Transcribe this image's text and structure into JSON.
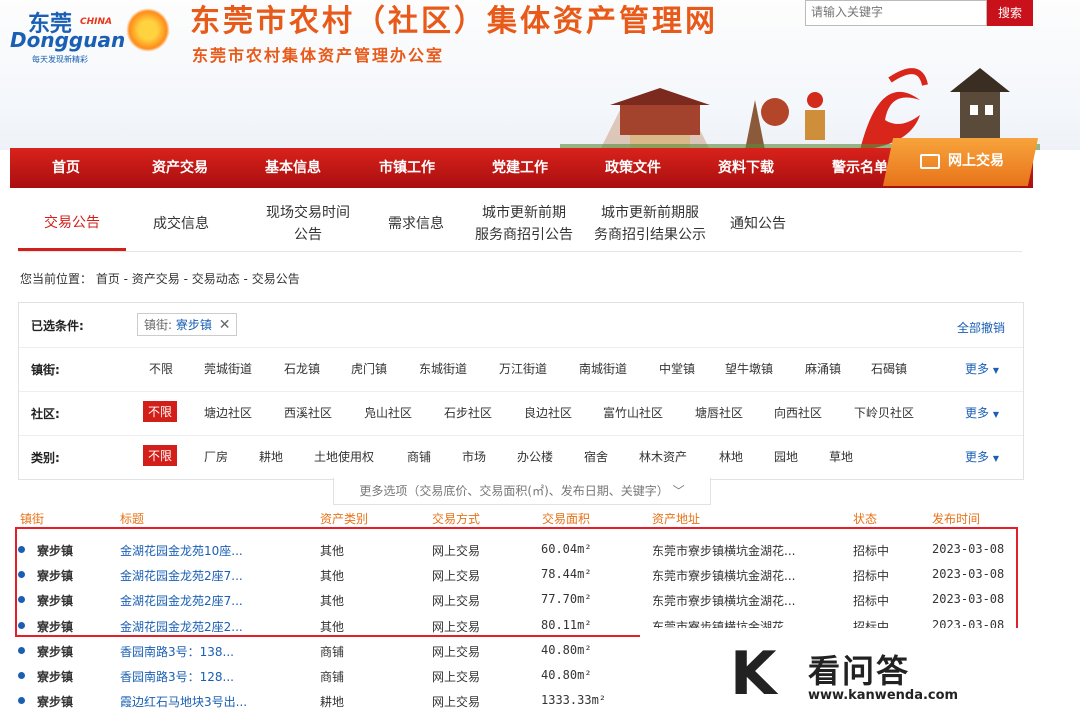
{
  "logo": {
    "cn": "东莞",
    "china": "CHINA",
    "en": "Dongguan",
    "slogan": "每天发现新精彩"
  },
  "site": {
    "title": "东莞市农村（社区）集体资产管理网",
    "subtitle": "东莞市农村集体资产管理办公室"
  },
  "search": {
    "placeholder": "请输入关键字",
    "button": "搜索"
  },
  "nav": {
    "items": [
      "首页",
      "资产交易",
      "基本信息",
      "市镇工作",
      "党建工作",
      "政策文件",
      "资料下载",
      "警示名单"
    ],
    "online": "网上交易"
  },
  "subtabs": [
    "交易公告",
    "成交信息",
    "现场交易时间\n公告",
    "需求信息",
    "城市更新前期\n服务商招引公告",
    "城市更新前期服\n务商招引结果公示",
    "通知公告"
  ],
  "breadcrumb": "您当前位置： 首页 - 资产交易 - 交易动态 - 交易公告",
  "filters": {
    "selected_label": "已选条件:",
    "selected_tag_key": "镇街:",
    "selected_tag_value": "寮步镇",
    "clear_all": "全部撤销",
    "town_label": "镇街:",
    "towns": [
      "不限",
      "莞城街道",
      "石龙镇",
      "虎门镇",
      "东城街道",
      "万江街道",
      "南城街道",
      "中堂镇",
      "望牛墩镇",
      "麻涌镇",
      "石碣镇"
    ],
    "community_label": "社区:",
    "communities": [
      "不限",
      "塘边社区",
      "西溪社区",
      "凫山社区",
      "石步社区",
      "良边社区",
      "富竹山社区",
      "塘唇社区",
      "向西社区",
      "下岭贝社区"
    ],
    "category_label": "类别:",
    "categories": [
      "不限",
      "厂房",
      "耕地",
      "土地使用权",
      "商铺",
      "市场",
      "办公楼",
      "宿舍",
      "林木资产",
      "林地",
      "园地",
      "草地"
    ],
    "more": "更多",
    "more_options": "更多选项（交易底价、交易面积(㎡)、发布日期、关键字）"
  },
  "table": {
    "headers": [
      "镇街",
      "标题",
      "资产类别",
      "交易方式",
      "交易面积",
      "资产地址",
      "状态",
      "发布时间"
    ],
    "rows": [
      [
        "寮步镇",
        "金湖花园金龙苑10座...",
        "其他",
        "网上交易",
        "60.04m²",
        "东莞市寮步镇横坑金湖花...",
        "招标中",
        "2023-03-08"
      ],
      [
        "寮步镇",
        "金湖花园金龙苑2座7...",
        "其他",
        "网上交易",
        "78.44m²",
        "东莞市寮步镇横坑金湖花...",
        "招标中",
        "2023-03-08"
      ],
      [
        "寮步镇",
        "金湖花园金龙苑2座7...",
        "其他",
        "网上交易",
        "77.70m²",
        "东莞市寮步镇横坑金湖花...",
        "招标中",
        "2023-03-08"
      ],
      [
        "寮步镇",
        "金湖花园金龙苑2座2...",
        "其他",
        "网上交易",
        "80.11m²",
        "东莞市寮步镇横坑金湖花",
        "招标中",
        "2023-03-08"
      ],
      [
        "寮步镇",
        "香园南路3号：138...",
        "商铺",
        "网上交易",
        "40.80m²",
        "",
        "",
        ""
      ],
      [
        "寮步镇",
        "香园南路3号：128...",
        "商铺",
        "网上交易",
        "40.80m²",
        "",
        "",
        ""
      ],
      [
        "寮步镇",
        "霞边红石马地块3号出...",
        "耕地",
        "网上交易",
        "1333.33m²",
        "",
        "",
        ""
      ]
    ]
  },
  "watermark": {
    "logo": "K",
    "name": "看问答",
    "url": "www.kanwenda.com"
  },
  "colors": {
    "nav_red": "#c8111a",
    "accent_orange": "#e8731a",
    "link_blue": "#1a5fb4",
    "title_orange": "#e85a1a"
  }
}
